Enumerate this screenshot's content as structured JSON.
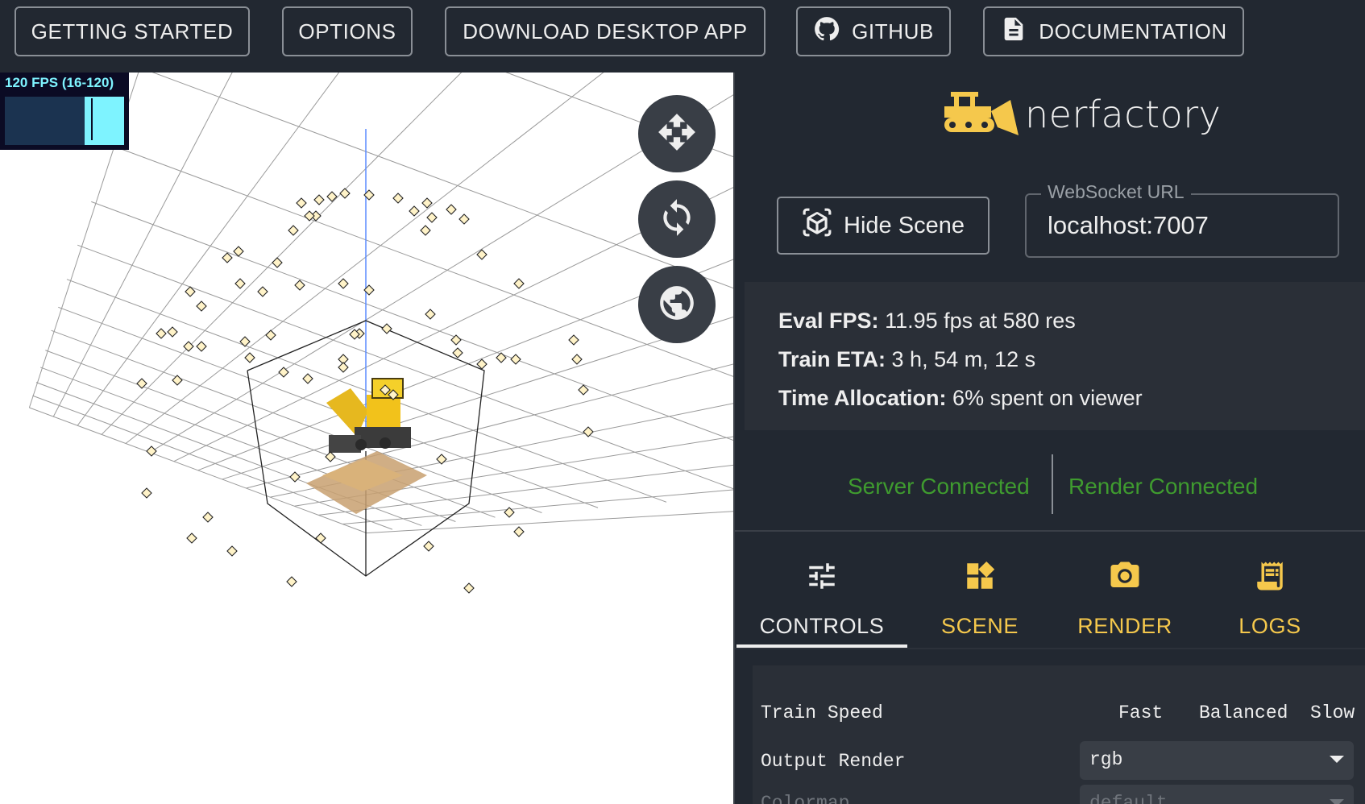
{
  "topbar": {
    "getting_started": "GETTING STARTED",
    "options": "OPTIONS",
    "download": "DOWNLOAD DESKTOP APP",
    "github": "GITHUB",
    "documentation": "DOCUMENTATION",
    "github_icon": "github-icon",
    "documentation_icon": "document-icon"
  },
  "viewport": {
    "fps_label": "120 FPS (16-120)",
    "fps_fill_fraction": 0.33,
    "buttons": [
      "move-icon",
      "rotate-icon",
      "globe-icon"
    ]
  },
  "panel": {
    "logo_text": "nerfactory",
    "hide_scene": "Hide Scene",
    "websocket_label": "WebSocket URL",
    "websocket_value": "localhost:7007",
    "stats": [
      {
        "label": "Eval FPS:",
        "value": "11.95 fps at 580 res"
      },
      {
        "label": "Train ETA:",
        "value": "3 h, 54 m, 12 s"
      },
      {
        "label": "Time Allocation:",
        "value": "6% spent on viewer"
      }
    ],
    "server_status": "Server Connected",
    "render_status": "Render Connected",
    "tabs": [
      {
        "label": "CONTROLS",
        "icon": "sliders-icon",
        "active": true
      },
      {
        "label": "SCENE",
        "icon": "widgets-icon",
        "active": false
      },
      {
        "label": "RENDER",
        "icon": "camera-icon",
        "active": false
      },
      {
        "label": "LOGS",
        "icon": "receipt-icon",
        "active": false
      }
    ],
    "controls": {
      "train_speed_label": "Train Speed",
      "speed_options": [
        "Fast",
        "Balanced",
        "Slow"
      ],
      "output_render_label": "Output Render",
      "output_render_value": "rgb",
      "colormap_label": "Colormap",
      "colormap_value": "default"
    }
  },
  "colors": {
    "background": "#222831",
    "accent_yellow": "#f5c84c",
    "status_green": "#3f9b2f",
    "fps_cyan": "#7ef3ff"
  }
}
